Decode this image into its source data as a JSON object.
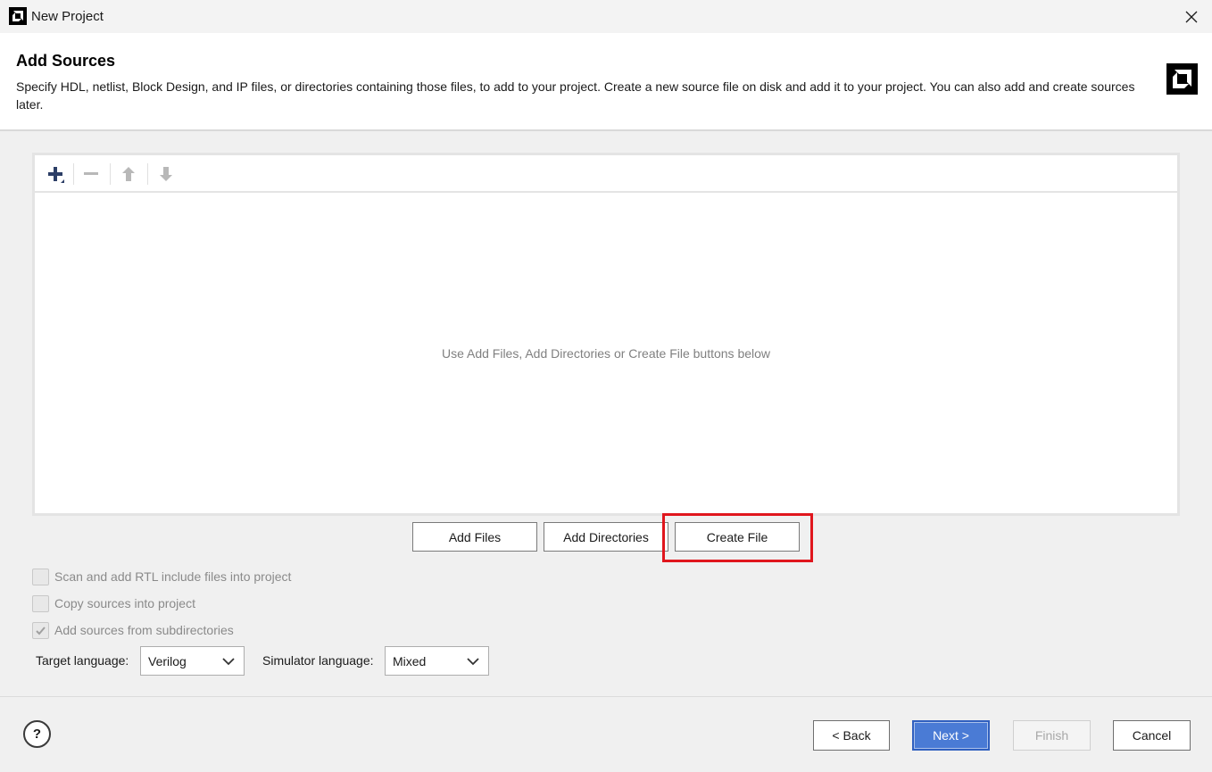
{
  "window": {
    "title": "New Project"
  },
  "header": {
    "title": "Add Sources",
    "description": "Specify HDL, netlist, Block Design, and IP files, or directories containing those files, to add to your project. Create a new source file on disk and add it to your project. You can also add and create sources later."
  },
  "toolbar": {
    "icons": [
      "add-icon",
      "remove-icon",
      "move-up-icon",
      "move-down-icon"
    ]
  },
  "sources_panel": {
    "empty_hint": "Use Add Files, Add Directories or Create File buttons below"
  },
  "actions": {
    "add_files": "Add Files",
    "add_directories": "Add Directories",
    "create_file": "Create File"
  },
  "options": [
    {
      "label": "Scan and add RTL include files into project",
      "checked": false,
      "enabled": false
    },
    {
      "label": "Copy sources into project",
      "checked": false,
      "enabled": false
    },
    {
      "label": "Add sources from subdirectories",
      "checked": true,
      "enabled": false
    }
  ],
  "languages": {
    "target_label": "Target language:",
    "target_value": "Verilog",
    "simulator_label": "Simulator language:",
    "simulator_value": "Mixed"
  },
  "footer": {
    "help": "?",
    "back": "< Back",
    "next": "Next >",
    "finish": "Finish",
    "cancel": "Cancel"
  },
  "colors": {
    "highlight": "#e0161d",
    "primary_button": "#4a7bd5"
  }
}
